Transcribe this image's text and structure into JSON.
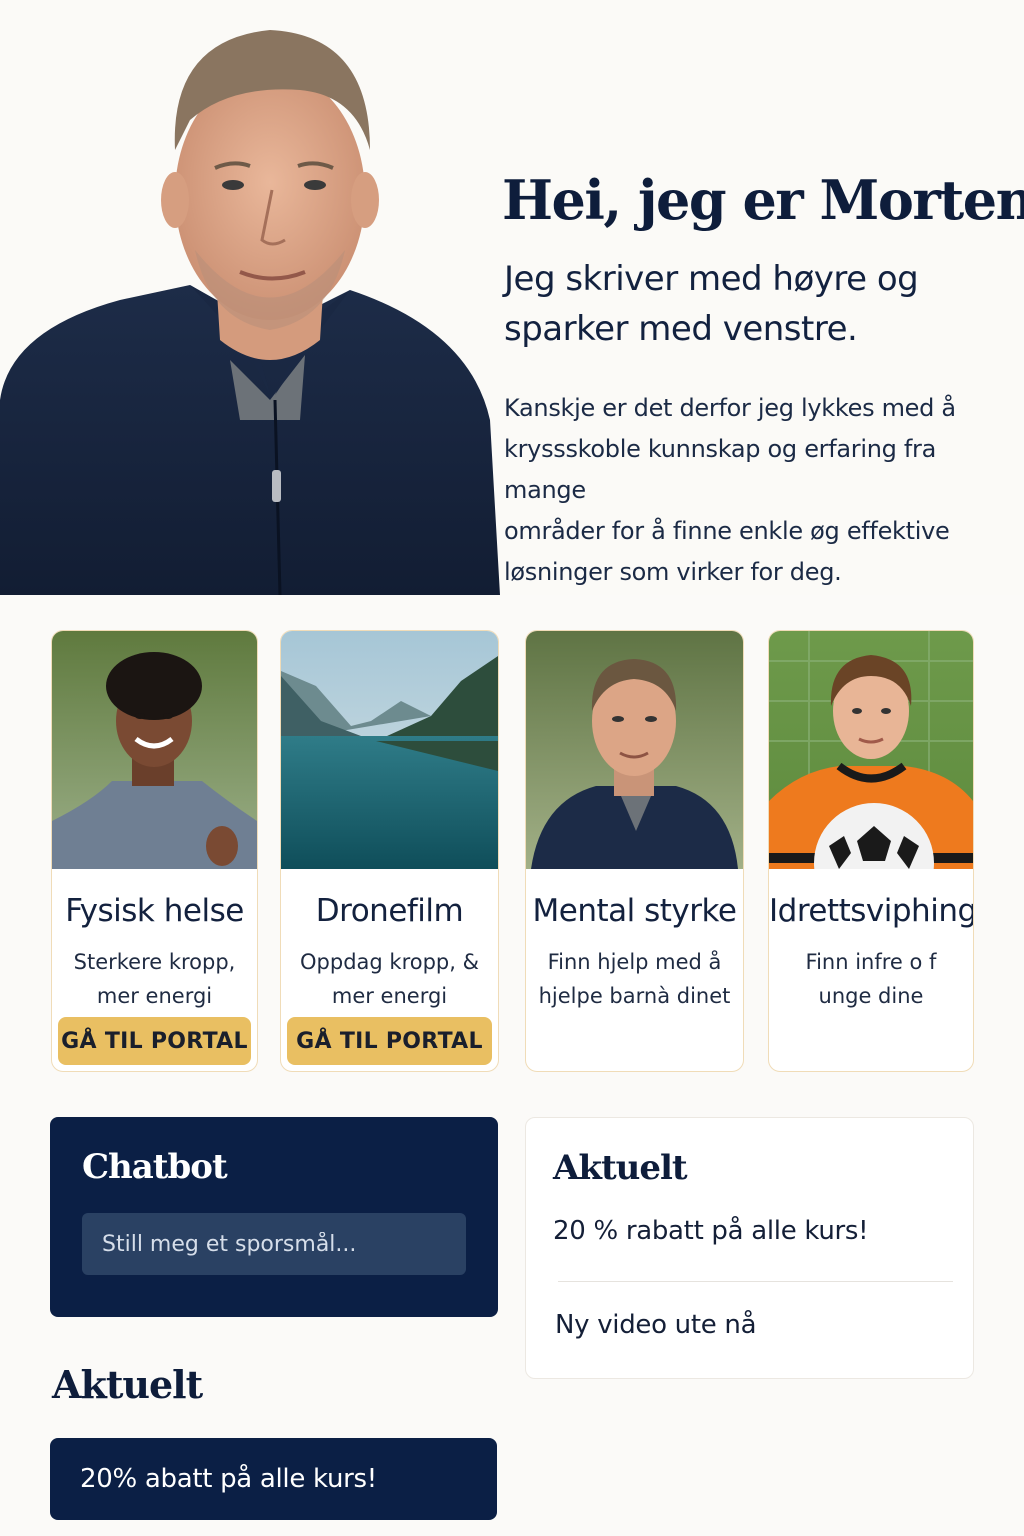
{
  "hero": {
    "title": "Hei, jeg er Morten.",
    "subtitle_lines": [
      "Jeg skriver med høyre og",
      "sparker med venstre."
    ],
    "body_lines": [
      "Kanskje er det derfor jeg lykkes med å",
      "kryssskoble kunnskap og erfaring fra mange",
      "områder for å finne enkle øg effektive",
      "løsninger som virker for deg."
    ]
  },
  "cards": [
    {
      "title": "Fysisk helse",
      "desc_lines": [
        "Sterkere kropp,",
        "mer energi"
      ],
      "button": "GÅ TIL PORTAL"
    },
    {
      "title": "Dronefilm",
      "desc_lines": [
        "Oppdag kropp, &",
        "mer energi"
      ],
      "button": "GÅ TIL PORTAL"
    },
    {
      "title": "Mental styrke",
      "desc_lines": [
        "Finn hjelp med å",
        "hjelpe barnà dinet"
      ]
    },
    {
      "title": "Idrettsviphing",
      "desc_lines": [
        "Finn infre o f",
        "unge dine"
      ]
    }
  ],
  "chatbot": {
    "title": "Chatbot",
    "placeholder": "Still meg et sporsmål..."
  },
  "news_panel": {
    "title": "Aktuelt",
    "items": [
      "20 % rabatt på alle kurs!",
      "Ny video ute nå"
    ]
  },
  "bottom_news": {
    "title": "Aktuelt",
    "banner": "20% abatt på alle kurs!"
  },
  "colors": {
    "navy": "#0b1f45",
    "accent_gold": "#e9bf62",
    "card_border": "#f0dcb8",
    "background": "#fbfaf8"
  }
}
